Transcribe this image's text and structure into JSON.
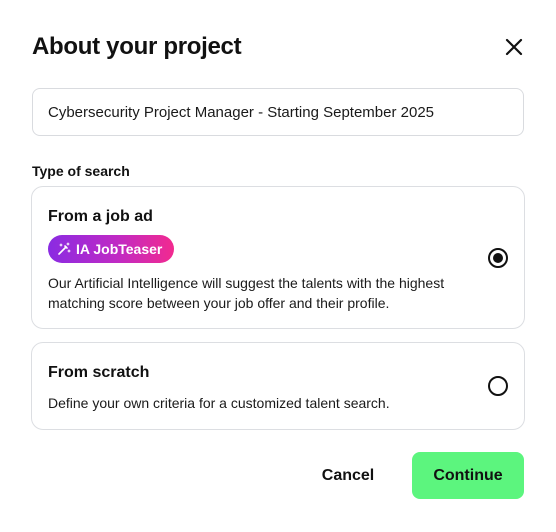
{
  "modal": {
    "title": "About your project",
    "close_icon": "close-icon"
  },
  "project": {
    "name_value": "Cybersecurity Project Manager - Starting September 2025"
  },
  "search_type": {
    "label": "Type of search",
    "options": [
      {
        "title": "From a job ad",
        "badge": {
          "label": "IA JobTeaser",
          "icon": "magic-wand-icon",
          "gradient": [
            "#8a2be2",
            "#f22a8f"
          ]
        },
        "description": "Our Artificial Intelligence will suggest the talents with the highest matching score between your job offer and their profile.",
        "selected": true
      },
      {
        "title": "From scratch",
        "description": "Define your own criteria for a customized talent search.",
        "selected": false
      }
    ]
  },
  "actions": {
    "cancel_label": "Cancel",
    "continue_label": "Continue",
    "continue_color": "#5cf57e"
  }
}
